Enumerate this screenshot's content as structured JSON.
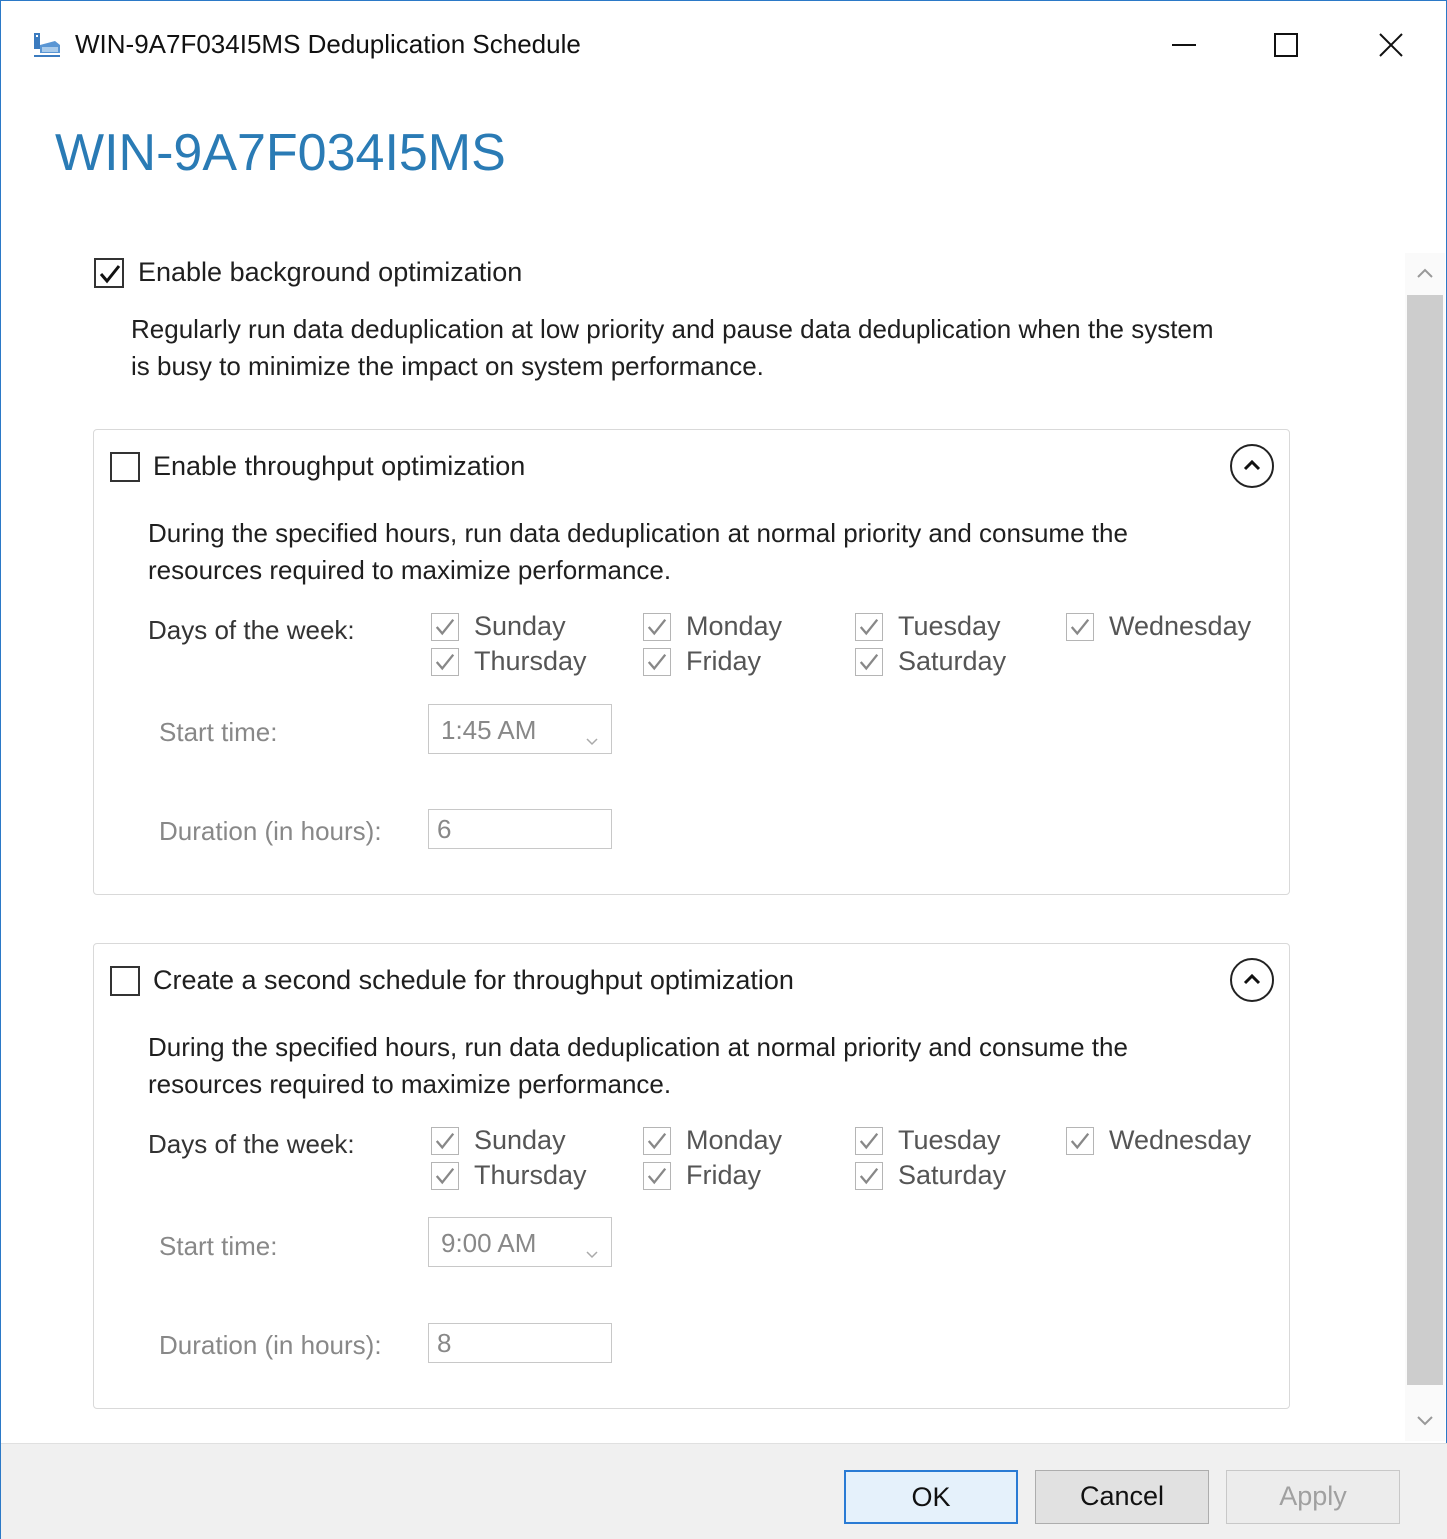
{
  "window": {
    "title": "WIN-9A7F034I5MS Deduplication Schedule",
    "controls": {
      "minimize_icon": "minimize-icon",
      "maximize_icon": "maximize-icon",
      "close_icon": "close-icon"
    }
  },
  "header": {
    "server_name": "WIN-9A7F034I5MS"
  },
  "background": {
    "checkbox_label": "Enable background optimization",
    "checked": true,
    "description_line1": "Regularly run data deduplication at low priority and pause data deduplication when the system",
    "description_line2": "is busy to minimize the impact on system performance."
  },
  "schedule1": {
    "checkbox_label": "Enable throughput optimization",
    "checked": false,
    "description_line1": "During the specified hours, run data deduplication at normal priority and consume the",
    "description_line2": "resources required to maximize performance.",
    "days_label": "Days of the week:",
    "days": [
      {
        "label": "Sunday",
        "checked": true
      },
      {
        "label": "Monday",
        "checked": true
      },
      {
        "label": "Tuesday",
        "checked": true
      },
      {
        "label": "Wednesday",
        "checked": true
      },
      {
        "label": "Thursday",
        "checked": true
      },
      {
        "label": "Friday",
        "checked": true
      },
      {
        "label": "Saturday",
        "checked": true
      }
    ],
    "start_time_label": "Start time:",
    "start_time_value": "1:45 AM",
    "duration_label": "Duration (in hours):",
    "duration_value": "6"
  },
  "schedule2": {
    "checkbox_label": "Create a second schedule for throughput optimization",
    "checked": false,
    "description_line1": "During the specified hours, run data deduplication at normal priority and consume the",
    "description_line2": "resources required to maximize performance.",
    "days_label": "Days of the week:",
    "days": [
      {
        "label": "Sunday",
        "checked": true
      },
      {
        "label": "Monday",
        "checked": true
      },
      {
        "label": "Tuesday",
        "checked": true
      },
      {
        "label": "Wednesday",
        "checked": true
      },
      {
        "label": "Thursday",
        "checked": true
      },
      {
        "label": "Friday",
        "checked": true
      },
      {
        "label": "Saturday",
        "checked": true
      }
    ],
    "start_time_label": "Start time:",
    "start_time_value": "9:00 AM",
    "duration_label": "Duration (in hours):",
    "duration_value": "8"
  },
  "footer": {
    "ok_label": "OK",
    "cancel_label": "Cancel",
    "apply_label": "Apply"
  },
  "colors": {
    "accent": "#2a7bb5",
    "window_border": "#2b79c7",
    "primary_button_border": "#2a7bd4"
  }
}
